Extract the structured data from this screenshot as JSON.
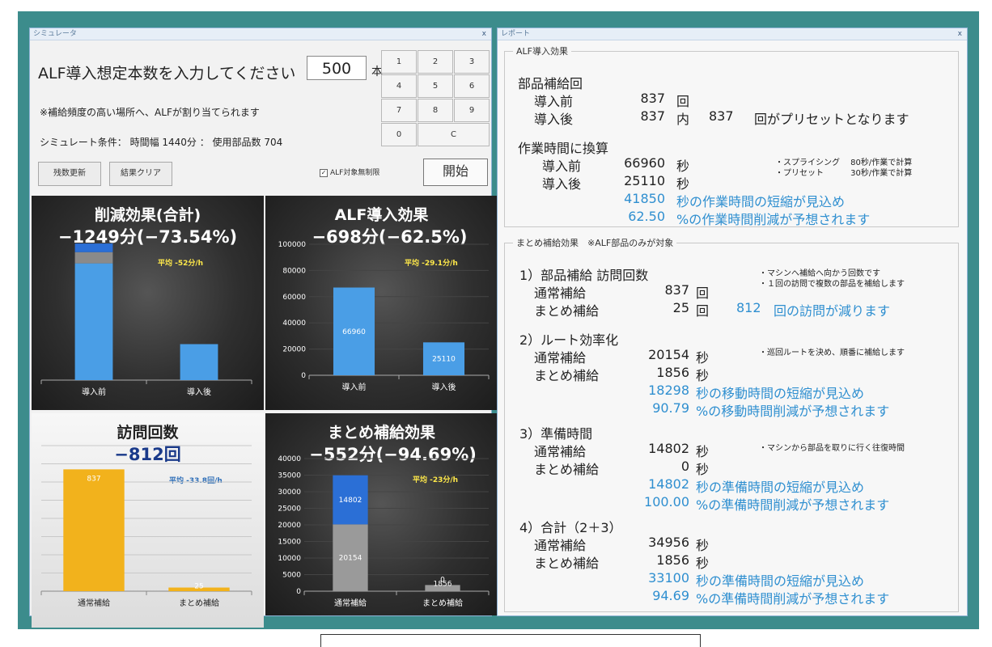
{
  "simulator": {
    "title": "シミュレータ",
    "close": "x",
    "prompt": "ALF導入想定本数を入力してください",
    "quantity": "500",
    "quantity_unit": "本",
    "note": "※補給頻度の高い場所へ、ALFが割り当てられます",
    "condition": "シミュレート条件： 時間幅 1440分 ： 使用部品数 704",
    "keypad": [
      "1",
      "2",
      "3",
      "4",
      "5",
      "6",
      "7",
      "8",
      "9",
      "0",
      "C"
    ],
    "buttons": {
      "refresh": "残数更新",
      "clear": "結果クリア",
      "start": "開始"
    },
    "checkbox": {
      "label": "ALF対象無制限",
      "checked": true,
      "mark": "✓"
    }
  },
  "chart_data": [
    {
      "type": "bar",
      "title": "削減効果(合計)",
      "subtitle": "−1249分(−73.54%)",
      "note": "平均 -52分/h",
      "categories": [
        "導入前",
        "導入後"
      ],
      "series": [
        {
          "values": [
            1460,
            450
          ]
        },
        {
          "values": [
            140,
            0
          ]
        },
        {
          "values": [
            108,
            0
          ]
        }
      ],
      "ylim": [
        0,
        1800
      ],
      "colors": [
        "#4a9ee6",
        "#8a8a8a",
        "#2b6fd6"
      ]
    },
    {
      "type": "bar",
      "title": "ALF導入効果",
      "subtitle": "−698分(−62.5%)",
      "note": "平均 -29.1分/h",
      "categories": [
        "導入前",
        "導入後"
      ],
      "values": [
        66960,
        25110
      ],
      "data_labels": [
        "66960",
        "25110"
      ],
      "yticks": [
        0,
        20000,
        40000,
        60000,
        80000,
        100000
      ],
      "ylim": [
        0,
        100000
      ],
      "color": "#4a9ee6"
    },
    {
      "type": "bar",
      "title": "訪問回数",
      "subtitle": "−812回",
      "note": "平均 -33.8回/h",
      "categories": [
        "通常補給",
        "まとめ補給"
      ],
      "values": [
        837,
        25
      ],
      "data_labels": [
        "837",
        "25"
      ],
      "ylim": [
        0,
        1000
      ],
      "color": "#f2b21c"
    },
    {
      "type": "bar",
      "title": "まとめ補給効果",
      "subtitle": "−552分(−94.69%)",
      "note": "平均 -23分/h",
      "categories": [
        "通常補給",
        "まとめ補給"
      ],
      "series": [
        {
          "values": [
            20154,
            1856
          ],
          "labels": [
            "20154",
            "1856"
          ]
        },
        {
          "values": [
            14802,
            0
          ],
          "labels": [
            "14802",
            "0"
          ]
        }
      ],
      "yticks": [
        0,
        5000,
        10000,
        15000,
        20000,
        25000,
        30000,
        35000,
        40000
      ],
      "ylim": [
        0,
        40000
      ],
      "colors": [
        "#9a9a9a",
        "#2b6fd6"
      ]
    }
  ],
  "report": {
    "title": "レポート",
    "close": "x",
    "alf": {
      "title": "ALF導入効果",
      "parts_heading": "部品補給回",
      "before_label": "導入前",
      "before_value": "837",
      "before_unit": "回",
      "after_label": "導入後",
      "after_value": "837",
      "after_mid": "内",
      "after_preset": "837",
      "after_suffix": "回がプリセットとなります",
      "work_heading": "作業時間に換算",
      "work_before_value": "66960",
      "work_after_value": "25110",
      "sec_unit": "秒",
      "note1": "・スプライシング　 80秒/作業で計算",
      "note2": "・プリセット　　　 30秒/作業で計算",
      "saving_value": "41850",
      "saving_text": "秒の作業時間の短縮が見込め",
      "percent_value": "62.50",
      "percent_text": "%の作業時間削減が予想されます"
    },
    "batch": {
      "title": "まとめ補給効果　※ALF部品のみが対象",
      "normal_label": "通常補給",
      "batch_label": "まとめ補給",
      "s1": {
        "heading": "1）部品補給 訪問回数",
        "note1": "・マシンへ補給へ向かう回数です",
        "note2": "・１回の訪問で複数の部品を補給します",
        "normal": "837",
        "batch": "25",
        "unit": "回",
        "reduced_value": "812",
        "reduced_text": "回の訪問が減ります"
      },
      "s2": {
        "heading": "2）ルート効率化",
        "note": "・巡回ルートを決め、順番に補給します",
        "normal": "20154",
        "batch": "1856",
        "unit": "秒",
        "saving_value": "18298",
        "saving_text": "秒の移動時間の短縮が見込め",
        "percent_value": "90.79",
        "percent_text": "%の移動時間削減が予想されます"
      },
      "s3": {
        "heading": "3）準備時間",
        "note": "・マシンから部品を取りに行く往復時間",
        "normal": "14802",
        "batch": "0",
        "unit": "秒",
        "saving_value": "14802",
        "saving_text": "秒の準備時間の短縮が見込め",
        "percent_value": "100.00",
        "percent_text": "%の準備時間削減が予想されます"
      },
      "s4": {
        "heading": "4）合計（2＋3）",
        "normal": "34956",
        "batch": "1856",
        "unit": "秒",
        "saving_value": "33100",
        "saving_text": "秒の準備時間の短縮が見込め",
        "percent_value": "94.69",
        "percent_text": "%の準備時間削減が予想されます"
      }
    }
  }
}
